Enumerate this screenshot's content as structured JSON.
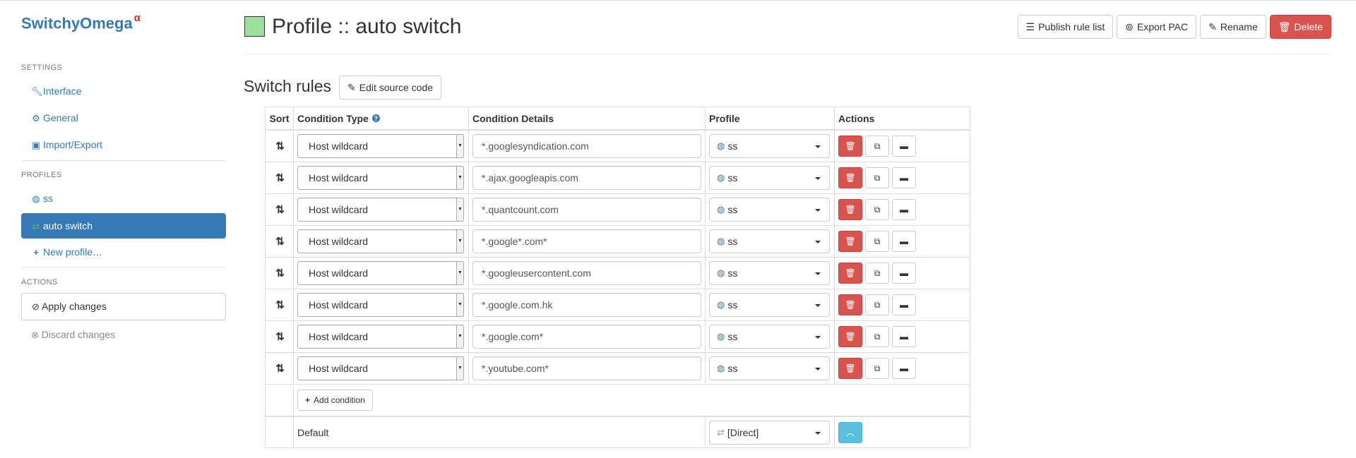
{
  "sidebar": {
    "brand": "SwitchyOmega",
    "brand_sup": "α",
    "sections": {
      "settings": "SETTINGS",
      "profiles": "PROFILES",
      "actions": "ACTIONS"
    },
    "settings_items": [
      {
        "label": "Interface",
        "icon": "wrench-icon"
      },
      {
        "label": "General",
        "icon": "gear-icon"
      },
      {
        "label": "Import/Export",
        "icon": "floppy-icon"
      }
    ],
    "profile_items": [
      {
        "label": "ss",
        "icon": "globe-icon"
      },
      {
        "label": "auto switch",
        "icon": "switch-icon"
      },
      {
        "label": "New profile…",
        "icon": "plus-icon"
      }
    ],
    "apply_label": "Apply changes",
    "discard_label": "Discard changes"
  },
  "header": {
    "title": "Profile :: auto switch",
    "swatch_color": "#9ce0a0",
    "publish_label": "Publish rule list",
    "export_label": "Export PAC",
    "rename_label": "Rename",
    "delete_label": "Delete"
  },
  "rules": {
    "title": "Switch rules",
    "edit_source_label": "Edit source code",
    "columns": {
      "sort": "Sort",
      "condition_type": "Condition Type",
      "condition_details": "Condition Details",
      "profile": "Profile",
      "actions": "Actions"
    },
    "items": [
      {
        "type": "Host wildcard",
        "details": "*.googlesyndication.com",
        "profile": "ss"
      },
      {
        "type": "Host wildcard",
        "details": "*.ajax.googleapis.com",
        "profile": "ss"
      },
      {
        "type": "Host wildcard",
        "details": "*.quantcount.com",
        "profile": "ss"
      },
      {
        "type": "Host wildcard",
        "details": "*.google*.com*",
        "profile": "ss"
      },
      {
        "type": "Host wildcard",
        "details": "*.googleusercontent.com",
        "profile": "ss"
      },
      {
        "type": "Host wildcard",
        "details": "*.google.com.hk",
        "profile": "ss"
      },
      {
        "type": "Host wildcard",
        "details": "*.google.com*",
        "profile": "ss"
      },
      {
        "type": "Host wildcard",
        "details": "*.youtube.com*",
        "profile": "ss"
      }
    ],
    "add_condition_label": "Add condition",
    "default_label": "Default",
    "default_profile": "[Direct]"
  },
  "colors": {
    "accent": "#337ab7",
    "danger": "#d9534f",
    "info": "#5bc0de"
  }
}
